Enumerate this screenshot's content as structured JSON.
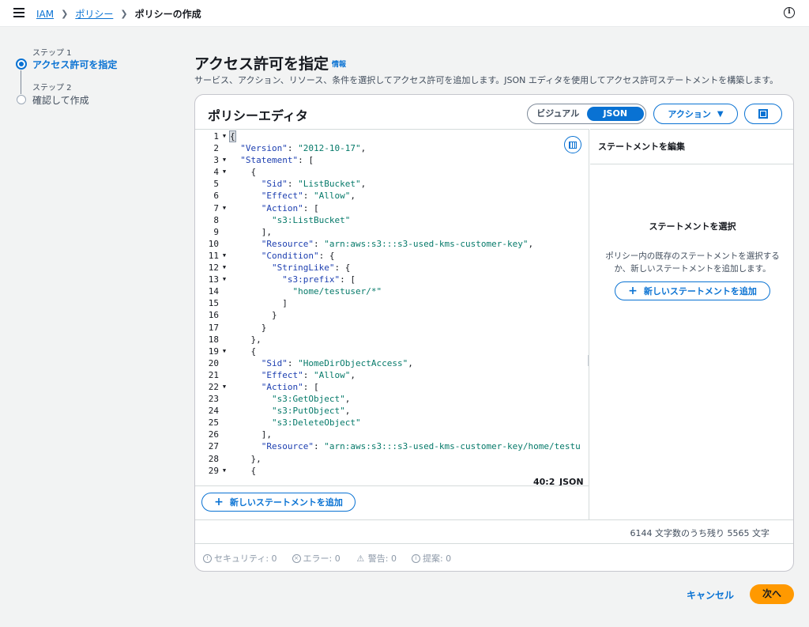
{
  "header": {
    "breadcrumb": [
      "IAM",
      "ポリシー",
      "ポリシーの作成"
    ]
  },
  "steps": [
    {
      "sub": "ステップ 1",
      "label": "アクセス許可を指定",
      "active": true
    },
    {
      "sub": "ステップ 2",
      "label": "確認して作成",
      "active": false
    }
  ],
  "page": {
    "title": "アクセス許可を指定",
    "info_link": "情報",
    "description": "サービス、アクション、リソース、条件を選択してアクセス許可を追加します。JSON エディタを使用してアクセス許可ステートメントを構築します。"
  },
  "editor_panel": {
    "title": "ポリシーエディタ",
    "mode_options": [
      "ビジュアル",
      "JSON"
    ],
    "selected_mode": "JSON",
    "actions_label": "アクション",
    "cursor_position": "40:2",
    "language": "JSON",
    "add_statement_label": "新しいステートメントを追加",
    "char_counter": "6144 文字数のうち残り 5565 文字",
    "code_lines": [
      {
        "n": "1",
        "fold": true,
        "indent": 0,
        "tokens": [
          {
            "t": "p",
            "v": "{"
          }
        ]
      },
      {
        "n": "2",
        "fold": false,
        "indent": 1,
        "tokens": [
          {
            "t": "k",
            "v": "\"Version\""
          },
          {
            "t": "p",
            "v": ": "
          },
          {
            "t": "s",
            "v": "\"2012-10-17\""
          },
          {
            "t": "p",
            "v": ","
          }
        ]
      },
      {
        "n": "3",
        "fold": true,
        "indent": 1,
        "tokens": [
          {
            "t": "k",
            "v": "\"Statement\""
          },
          {
            "t": "p",
            "v": ": ["
          }
        ]
      },
      {
        "n": "4",
        "fold": true,
        "indent": 2,
        "tokens": [
          {
            "t": "p",
            "v": "{"
          }
        ]
      },
      {
        "n": "5",
        "fold": false,
        "indent": 3,
        "tokens": [
          {
            "t": "k",
            "v": "\"Sid\""
          },
          {
            "t": "p",
            "v": ": "
          },
          {
            "t": "s",
            "v": "\"ListBucket\""
          },
          {
            "t": "p",
            "v": ","
          }
        ]
      },
      {
        "n": "6",
        "fold": false,
        "indent": 3,
        "tokens": [
          {
            "t": "k",
            "v": "\"Effect\""
          },
          {
            "t": "p",
            "v": ": "
          },
          {
            "t": "s",
            "v": "\"Allow\""
          },
          {
            "t": "p",
            "v": ","
          }
        ]
      },
      {
        "n": "7",
        "fold": true,
        "indent": 3,
        "tokens": [
          {
            "t": "k",
            "v": "\"Action\""
          },
          {
            "t": "p",
            "v": ": ["
          }
        ]
      },
      {
        "n": "8",
        "fold": false,
        "indent": 4,
        "tokens": [
          {
            "t": "s",
            "v": "\"s3:ListBucket\""
          }
        ]
      },
      {
        "n": "9",
        "fold": false,
        "indent": 3,
        "tokens": [
          {
            "t": "p",
            "v": "],"
          }
        ]
      },
      {
        "n": "10",
        "fold": false,
        "indent": 3,
        "tokens": [
          {
            "t": "k",
            "v": "\"Resource\""
          },
          {
            "t": "p",
            "v": ": "
          },
          {
            "t": "s",
            "v": "\"arn:aws:s3:::s3-used-kms-customer-key\""
          },
          {
            "t": "p",
            "v": ","
          }
        ]
      },
      {
        "n": "11",
        "fold": true,
        "indent": 3,
        "tokens": [
          {
            "t": "k",
            "v": "\"Condition\""
          },
          {
            "t": "p",
            "v": ": {"
          }
        ]
      },
      {
        "n": "12",
        "fold": true,
        "indent": 4,
        "tokens": [
          {
            "t": "k",
            "v": "\"StringLike\""
          },
          {
            "t": "p",
            "v": ": {"
          }
        ]
      },
      {
        "n": "13",
        "fold": true,
        "indent": 5,
        "tokens": [
          {
            "t": "k",
            "v": "\"s3:prefix\""
          },
          {
            "t": "p",
            "v": ": ["
          }
        ]
      },
      {
        "n": "14",
        "fold": false,
        "indent": 6,
        "tokens": [
          {
            "t": "s",
            "v": "\"home/testuser/*\""
          }
        ]
      },
      {
        "n": "15",
        "fold": false,
        "indent": 5,
        "tokens": [
          {
            "t": "p",
            "v": "]"
          }
        ]
      },
      {
        "n": "16",
        "fold": false,
        "indent": 4,
        "tokens": [
          {
            "t": "p",
            "v": "}"
          }
        ]
      },
      {
        "n": "17",
        "fold": false,
        "indent": 3,
        "tokens": [
          {
            "t": "p",
            "v": "}"
          }
        ]
      },
      {
        "n": "18",
        "fold": false,
        "indent": 2,
        "tokens": [
          {
            "t": "p",
            "v": "},"
          }
        ]
      },
      {
        "n": "19",
        "fold": true,
        "indent": 2,
        "tokens": [
          {
            "t": "p",
            "v": "{"
          }
        ]
      },
      {
        "n": "20",
        "fold": false,
        "indent": 3,
        "tokens": [
          {
            "t": "k",
            "v": "\"Sid\""
          },
          {
            "t": "p",
            "v": ": "
          },
          {
            "t": "s",
            "v": "\"HomeDirObjectAccess\""
          },
          {
            "t": "p",
            "v": ","
          }
        ]
      },
      {
        "n": "21",
        "fold": false,
        "indent": 3,
        "tokens": [
          {
            "t": "k",
            "v": "\"Effect\""
          },
          {
            "t": "p",
            "v": ": "
          },
          {
            "t": "s",
            "v": "\"Allow\""
          },
          {
            "t": "p",
            "v": ","
          }
        ]
      },
      {
        "n": "22",
        "fold": true,
        "indent": 3,
        "tokens": [
          {
            "t": "k",
            "v": "\"Action\""
          },
          {
            "t": "p",
            "v": ": ["
          }
        ]
      },
      {
        "n": "23",
        "fold": false,
        "indent": 4,
        "tokens": [
          {
            "t": "s",
            "v": "\"s3:GetObject\""
          },
          {
            "t": "p",
            "v": ","
          }
        ]
      },
      {
        "n": "24",
        "fold": false,
        "indent": 4,
        "tokens": [
          {
            "t": "s",
            "v": "\"s3:PutObject\""
          },
          {
            "t": "p",
            "v": ","
          }
        ]
      },
      {
        "n": "25",
        "fold": false,
        "indent": 4,
        "tokens": [
          {
            "t": "s",
            "v": "\"s3:DeleteObject\""
          }
        ]
      },
      {
        "n": "26",
        "fold": false,
        "indent": 3,
        "tokens": [
          {
            "t": "p",
            "v": "],"
          }
        ]
      },
      {
        "n": "27",
        "fold": false,
        "indent": 3,
        "tokens": [
          {
            "t": "k",
            "v": "\"Resource\""
          },
          {
            "t": "p",
            "v": ": "
          },
          {
            "t": "s",
            "v": "\"arn:aws:s3:::s3-used-kms-customer-key/home/testu"
          }
        ]
      },
      {
        "n": "28",
        "fold": false,
        "indent": 2,
        "tokens": [
          {
            "t": "p",
            "v": "},"
          }
        ]
      },
      {
        "n": "29",
        "fold": true,
        "indent": 2,
        "tokens": [
          {
            "t": "p",
            "v": "{"
          }
        ]
      }
    ]
  },
  "statement_panel": {
    "header": "ステートメントを編集",
    "title": "ステートメントを選択",
    "description": "ポリシー内の既存のステートメントを選択するか、新しいステートメントを追加します。",
    "add_label": "新しいステートメントを追加"
  },
  "issues": [
    {
      "icon": "security-icon",
      "glyph": "!",
      "label": "セキュリティ: 0"
    },
    {
      "icon": "error-icon",
      "glyph": "×",
      "label": "エラー: 0"
    },
    {
      "icon": "warning-icon",
      "glyph": "⚠",
      "label": "警告: 0"
    },
    {
      "icon": "suggestion-icon",
      "glyph": "i",
      "label": "提案: 0"
    }
  ],
  "footer": {
    "cancel_label": "キャンセル",
    "next_label": "次へ"
  },
  "colors": {
    "accent": "#0972d3",
    "primary_button": "#ff9900",
    "json_key": "#1d3fb0",
    "json_string": "#067a6a"
  }
}
